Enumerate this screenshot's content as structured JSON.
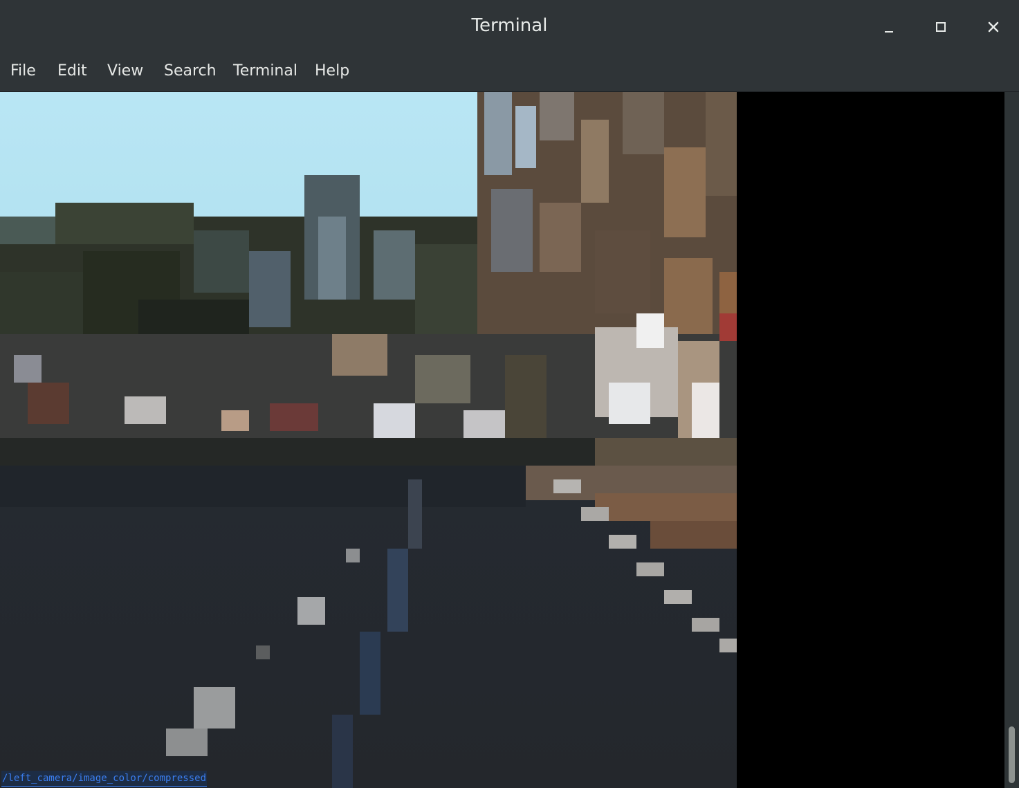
{
  "window": {
    "title": "Terminal",
    "controls": {
      "minimize": "minimize-icon",
      "maximize": "maximize-icon",
      "close": "close-icon"
    }
  },
  "menubar": {
    "items": [
      "File",
      "Edit",
      "View",
      "Search",
      "Terminal",
      "Help"
    ]
  },
  "terminal": {
    "background": "#000000",
    "image_content": "pixelated street-camera frame rendered in the terminal",
    "topic_text": "/left_camera/image_color/compressed",
    "topic_highlight_color": "#3b7ff2"
  }
}
